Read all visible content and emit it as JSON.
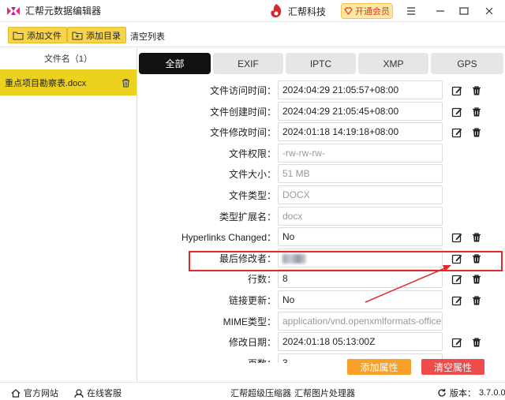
{
  "app": {
    "title": "汇帮元数据编辑器",
    "brand": "汇帮科技",
    "vip_label": "开通会员"
  },
  "toolbar": {
    "add_file": "添加文件",
    "add_dir": "添加目录",
    "clear_list": "清空列表"
  },
  "sidebar": {
    "header": "文件名（1）",
    "files": [
      {
        "name": "重点项目勘察表.docx"
      }
    ]
  },
  "tabs": [
    "全部",
    "EXIF",
    "IPTC",
    "XMP",
    "GPS"
  ],
  "properties": [
    {
      "label": "文件访问时间：",
      "value": "2024:04:29 21:05:57+08:00",
      "editable": true
    },
    {
      "label": "文件创建时间：",
      "value": "2024:04:29 21:05:45+08:00",
      "editable": true
    },
    {
      "label": "文件修改时间：",
      "value": "2024:01:18 14:19:18+08:00",
      "editable": true
    },
    {
      "label": "文件权限：",
      "value": "-rw-rw-rw-",
      "editable": false
    },
    {
      "label": "文件大小：",
      "value": "51 MB",
      "editable": false
    },
    {
      "label": "文件类型：",
      "value": "DOCX",
      "editable": false
    },
    {
      "label": "类型扩展名：",
      "value": "docx",
      "editable": false
    },
    {
      "label": "Hyperlinks Changed：",
      "value": "No",
      "editable": true
    },
    {
      "label": "最后修改者：",
      "value": "",
      "editable": true
    },
    {
      "label": "行数：",
      "value": "8",
      "editable": true
    },
    {
      "label": "链接更新：",
      "value": "No",
      "editable": true
    },
    {
      "label": "MIME类型：",
      "value": "application/vnd.openxmlformats-officedocument",
      "editable": false
    },
    {
      "label": "修改日期：",
      "value": "2024:01:18 05:13:00Z",
      "editable": true
    },
    {
      "label": "页数：",
      "value": "3",
      "editable": true
    }
  ],
  "actions": {
    "add_property": "添加属性",
    "clear_properties": "清空属性"
  },
  "statusbar": {
    "website": "官方网站",
    "support": "在线客服",
    "compressor": "汇帮超级压缩器",
    "image_tool": "汇帮图片处理器",
    "version_label": "版本：",
    "version": "3.7.0.0"
  },
  "colors": {
    "accent_yellow": "#ecd11f",
    "highlight_red": "#e22a2a",
    "add_orange": "#f7a12a",
    "clear_red": "#ee4b4b"
  }
}
